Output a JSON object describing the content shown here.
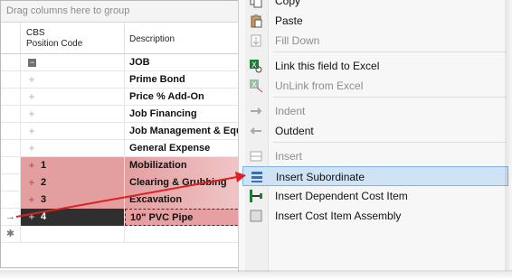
{
  "grid": {
    "group_panel": "Drag columns here to group",
    "columns": {
      "cbs": "CBS\nPosition Code",
      "description": "Description"
    },
    "rows": [
      {
        "expander": "minus",
        "code": "",
        "description": "JOB",
        "style": "plain"
      },
      {
        "expander": "+",
        "code": "",
        "description": "Prime Bond",
        "style": "plain"
      },
      {
        "expander": "+",
        "code": "",
        "description": "Price % Add-On",
        "style": "plain"
      },
      {
        "expander": "+",
        "code": "",
        "description": "Job Financing",
        "style": "plain"
      },
      {
        "expander": "+",
        "code": "",
        "description": "Job Management & Equ",
        "style": "plain"
      },
      {
        "expander": "+",
        "code": "",
        "description": "General Expense",
        "style": "plain"
      },
      {
        "expander": "+",
        "code": "1",
        "description": "Mobilization",
        "style": "pink"
      },
      {
        "expander": "+",
        "code": "2",
        "description": "Clearing & Grubbing",
        "style": "pink"
      },
      {
        "expander": "+",
        "code": "3",
        "description": "Excavation",
        "style": "pink"
      },
      {
        "expander": "+",
        "code": "4",
        "description": "10\" PVC Pipe",
        "style": "dark",
        "indicator": "→"
      },
      {
        "expander": "",
        "code": "",
        "description": "",
        "style": "new",
        "indicator": "✱"
      }
    ]
  },
  "context_menu": {
    "items": [
      {
        "label": "Copy",
        "icon": "copy-icon",
        "disabled": false
      },
      {
        "label": "Paste",
        "icon": "paste-icon",
        "disabled": false
      },
      {
        "label": "Fill Down",
        "icon": "fill-down-icon",
        "disabled": true
      },
      {
        "label": "Link this field to Excel",
        "icon": "excel-link-icon",
        "disabled": false
      },
      {
        "label": "UnLink from Excel",
        "icon": "excel-unlink-icon",
        "disabled": true
      },
      {
        "label": "Indent",
        "icon": "indent-icon",
        "disabled": true
      },
      {
        "label": "Outdent",
        "icon": "outdent-icon",
        "disabled": false
      },
      {
        "label": "Insert",
        "icon": "insert-icon",
        "disabled": true
      },
      {
        "label": "Insert Subordinate",
        "icon": "insert-subordinate-icon",
        "disabled": false,
        "highlighted": true
      },
      {
        "label": "Insert Dependent Cost Item",
        "icon": "insert-dependent-icon",
        "disabled": false
      },
      {
        "label": "Insert Cost Item Assembly",
        "icon": "insert-assembly-icon",
        "disabled": false
      }
    ]
  },
  "colors": {
    "highlight": "#cfe3f6",
    "row_pink": "#e39ea0",
    "arrow": "#e02020"
  }
}
